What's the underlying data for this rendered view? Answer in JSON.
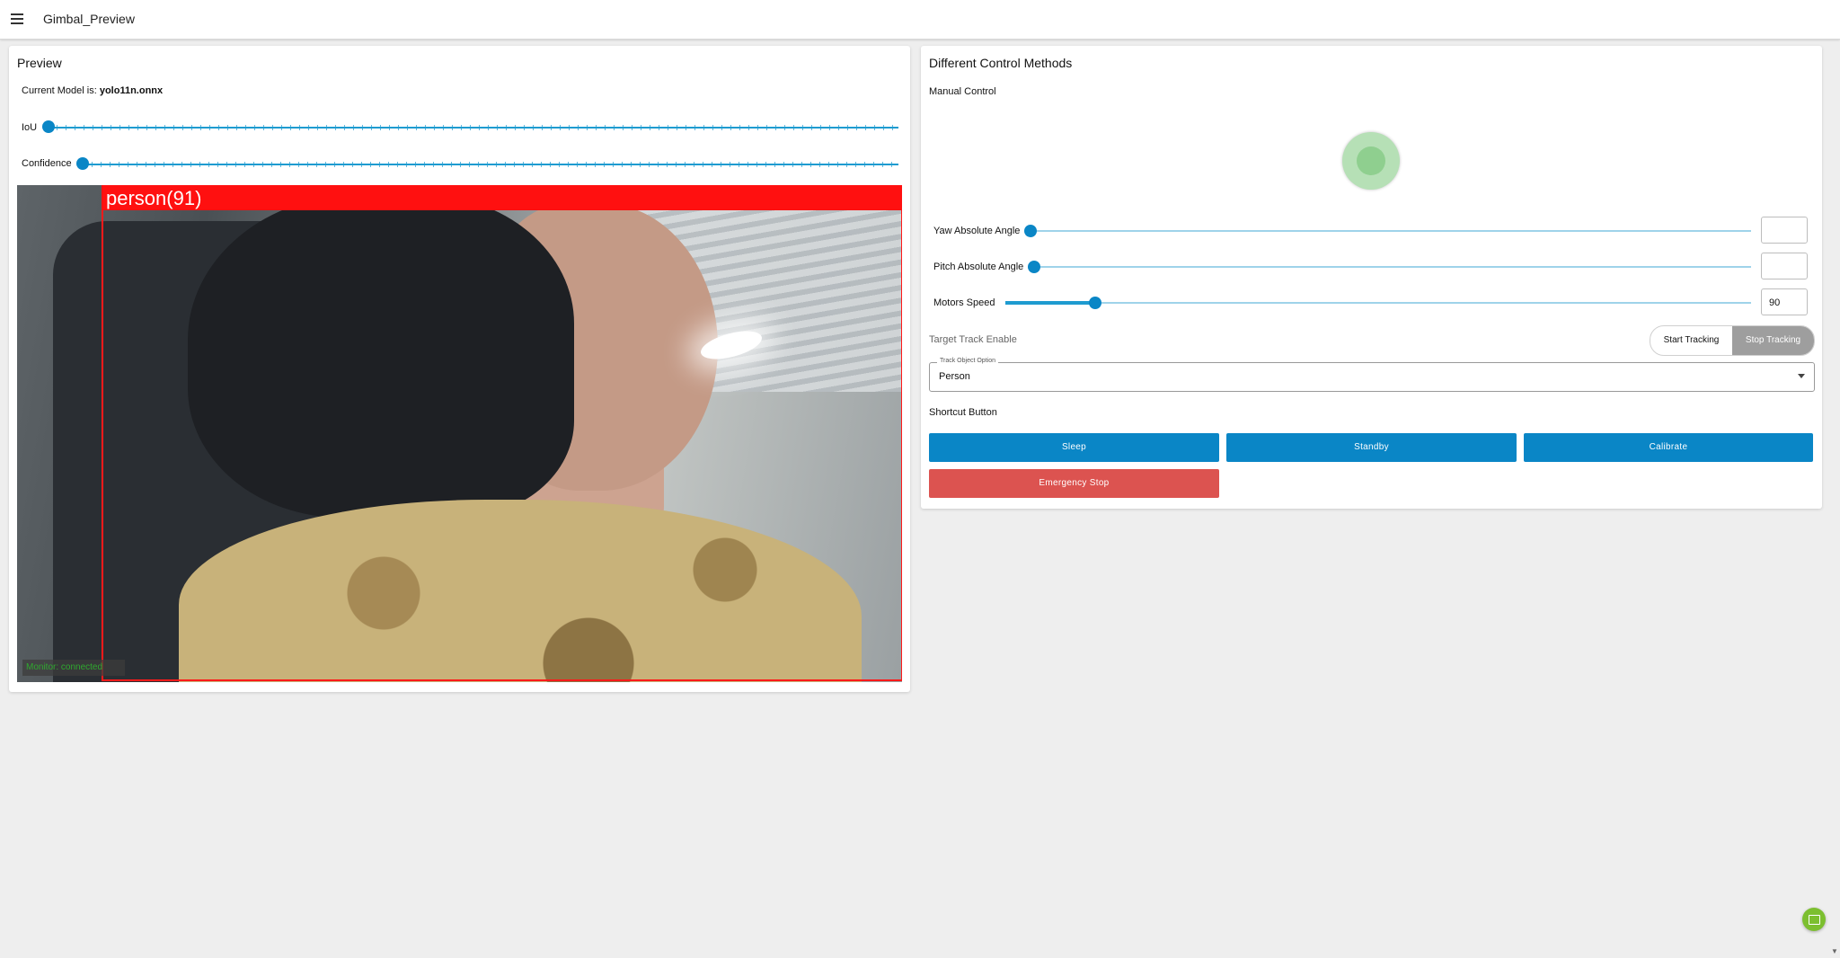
{
  "app": {
    "title": "Gimbal_Preview"
  },
  "preview": {
    "title": "Preview",
    "model_prefix": "Current Model is:",
    "model_name": "yolo11n.onnx",
    "iou_label": "IoU",
    "iou_value_fraction": 0.0,
    "confidence_label": "Confidence",
    "confidence_value_fraction": 0.0,
    "detection_label": "person(91)",
    "status_chip": "Monitor: connected"
  },
  "control": {
    "title": "Different Control Methods",
    "manual_label": "Manual Control",
    "yaw_label": "Yaw Absolute Angle",
    "yaw_value": "",
    "pitch_label": "Pitch Absolute Angle",
    "pitch_value": "",
    "motors_label": "Motors Speed",
    "motors_value": "90",
    "motors_fraction": 0.12,
    "track_enable_label": "Target Track Enable",
    "start_tracking": "Start Tracking",
    "stop_tracking": "Stop Tracking",
    "track_option_legend": "Track Object Option",
    "track_option_value": "Person",
    "shortcut_label": "Shortcut Button",
    "sleep": "Sleep",
    "standby": "Standby",
    "calibrate": "Calibrate",
    "emergency_stop": "Emergency Stop"
  },
  "colors": {
    "primary": "#0a86c6",
    "danger": "#dc5350",
    "detection": "#ff1010",
    "joystick": "#8fcf8f",
    "active_toggle": "#9e9e9e"
  },
  "icons": {
    "menu": "hamburger-icon",
    "fab": "calendar-icon",
    "select": "caret-down-icon"
  }
}
